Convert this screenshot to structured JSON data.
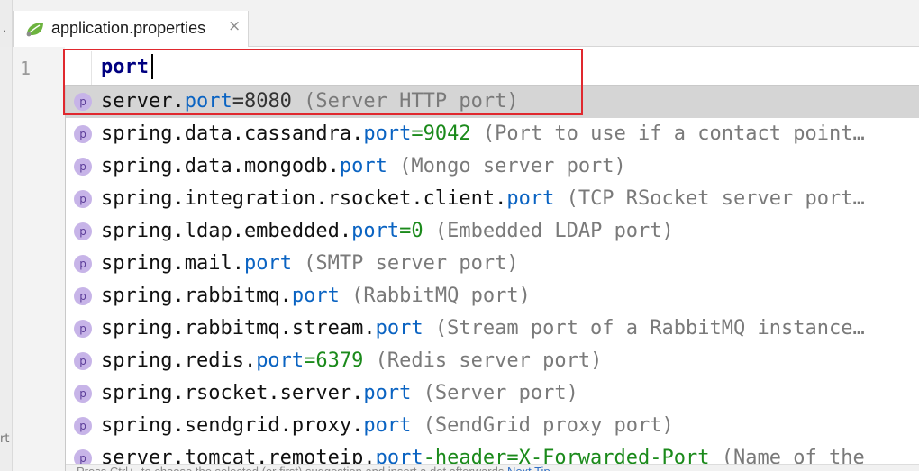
{
  "tab": {
    "title": "application.properties",
    "close_glyph": "×",
    "icon": "spring-leaf-icon",
    "icon_color": "#6db33f"
  },
  "gutter": {
    "line_number": "1",
    "left_strip_text": "rt"
  },
  "editor": {
    "typed_text": "port"
  },
  "completion": {
    "icon_letter": "p",
    "icon_color": "#c7b4e8",
    "selected_index": 0,
    "items": [
      {
        "prefix": "server.",
        "key": "port",
        "value": "=8080",
        "value_style": "plain",
        "desc": " (Server HTTP port)"
      },
      {
        "prefix": "spring.data.cassandra.",
        "key": "port",
        "value": "=9042",
        "value_style": "green",
        "desc": " (Port to use if a contact point…"
      },
      {
        "prefix": "spring.data.mongodb.",
        "key": "port",
        "value": "",
        "value_style": "plain",
        "desc": " (Mongo server port)"
      },
      {
        "prefix": "spring.integration.rsocket.client.",
        "key": "port",
        "value": "",
        "value_style": "plain",
        "desc": " (TCP RSocket server port…"
      },
      {
        "prefix": "spring.ldap.embedded.",
        "key": "port",
        "value": "=0",
        "value_style": "green",
        "desc": " (Embedded LDAP port)"
      },
      {
        "prefix": "spring.mail.",
        "key": "port",
        "value": "",
        "value_style": "plain",
        "desc": " (SMTP server port)"
      },
      {
        "prefix": "spring.rabbitmq.",
        "key": "port",
        "value": "",
        "value_style": "plain",
        "desc": " (RabbitMQ port)"
      },
      {
        "prefix": "spring.rabbitmq.stream.",
        "key": "port",
        "value": "",
        "value_style": "plain",
        "desc": " (Stream port of a RabbitMQ instance…"
      },
      {
        "prefix": "spring.redis.",
        "key": "port",
        "value": "=6379",
        "value_style": "green",
        "desc": " (Redis server port)"
      },
      {
        "prefix": "spring.rsocket.server.",
        "key": "port",
        "value": "",
        "value_style": "plain",
        "desc": " (Server port)"
      },
      {
        "prefix": "spring.sendgrid.proxy.",
        "key": "port",
        "value": "",
        "value_style": "plain",
        "desc": " (SendGrid proxy port)"
      },
      {
        "prefix": "server.tomcat.remoteip.",
        "key": "port",
        "value": "-header=X-Forwarded-Port",
        "value_style": "green",
        "desc": " (Name of the"
      }
    ],
    "footer": {
      "text": "Press Ctrl+. to choose the selected (or first) suggestion and insert a dot afterwards  ",
      "link": "Next Tip"
    }
  },
  "colors": {
    "highlight": "#e0282e",
    "key_blue": "#0a63c2",
    "value_green": "#1b8a1b",
    "typed_text": "#000080"
  }
}
